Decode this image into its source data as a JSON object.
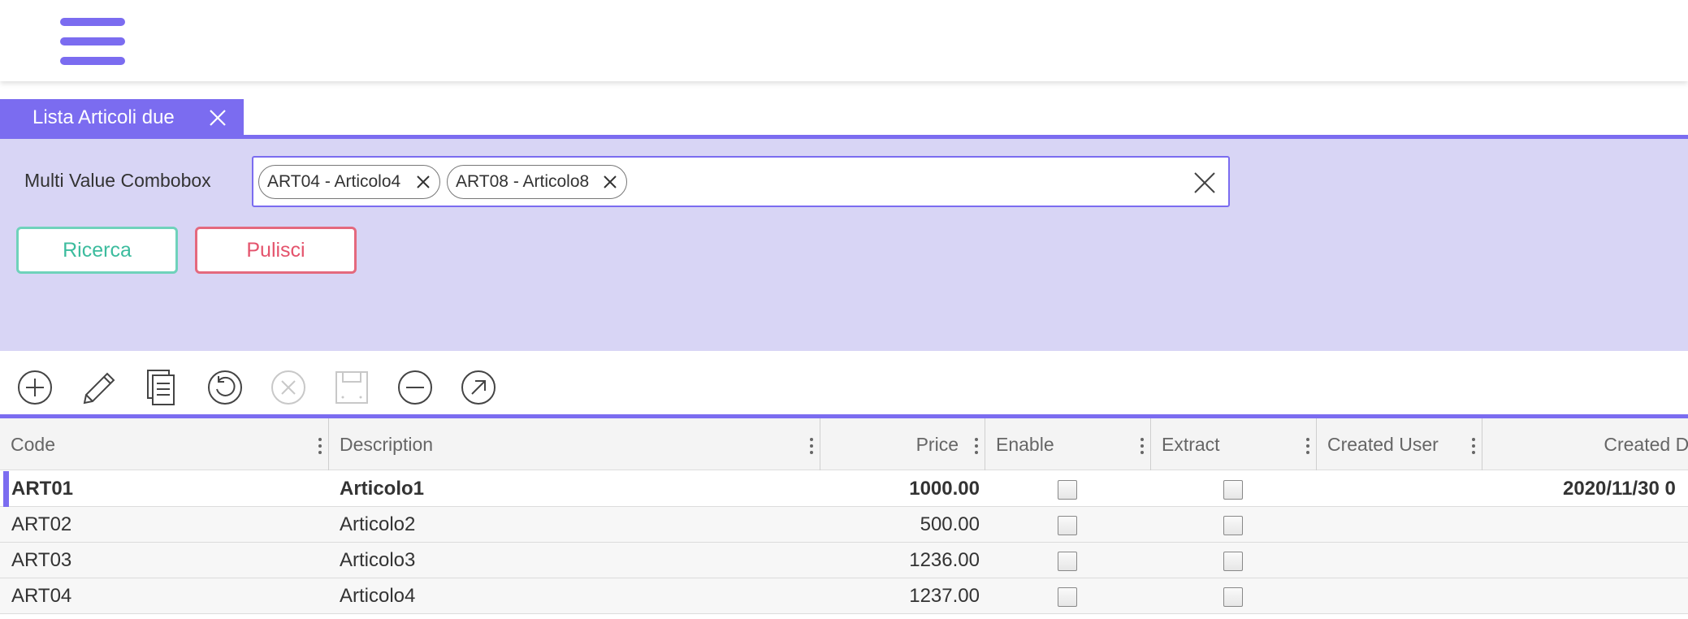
{
  "app": {
    "menu_icon": "hamburger-menu-icon"
  },
  "tab": {
    "label": "Lista Articoli due",
    "close_icon": "close-icon"
  },
  "filters": {
    "combo_label": "Multi Value Combobox",
    "chips": [
      {
        "label": "ART04 - Articolo4"
      },
      {
        "label": "ART08 - Articolo8"
      }
    ],
    "search_label": "Ricerca",
    "clear_label": "Pulisci"
  },
  "toolbar": {
    "icons": [
      "add-icon",
      "edit-icon",
      "copy-icon",
      "refresh-icon",
      "cancel-icon",
      "save-icon",
      "remove-icon",
      "export-icon"
    ]
  },
  "grid": {
    "columns": [
      {
        "label": "Code"
      },
      {
        "label": "Description"
      },
      {
        "label": "Price"
      },
      {
        "label": "Enable"
      },
      {
        "label": "Extract"
      },
      {
        "label": "Created User"
      },
      {
        "label": "Created Da"
      }
    ],
    "rows": [
      {
        "code": "ART01",
        "description": "Articolo1",
        "price": "1000.00",
        "enable": false,
        "extract": false,
        "created_user": "",
        "created_date": "2020/11/30 0",
        "selected": true
      },
      {
        "code": "ART02",
        "description": "Articolo2",
        "price": "500.00",
        "enable": false,
        "extract": false,
        "created_user": "",
        "created_date": "",
        "selected": false
      },
      {
        "code": "ART03",
        "description": "Articolo3",
        "price": "1236.00",
        "enable": false,
        "extract": false,
        "created_user": "",
        "created_date": "",
        "selected": false
      },
      {
        "code": "ART04",
        "description": "Articolo4",
        "price": "1237.00",
        "enable": false,
        "extract": false,
        "created_user": "",
        "created_date": "",
        "selected": false
      }
    ]
  },
  "colors": {
    "accent": "#7b6cf0",
    "filter_bg": "#d8d5f5",
    "search_green": "#3cbc9e",
    "clear_red": "#e4536c"
  }
}
